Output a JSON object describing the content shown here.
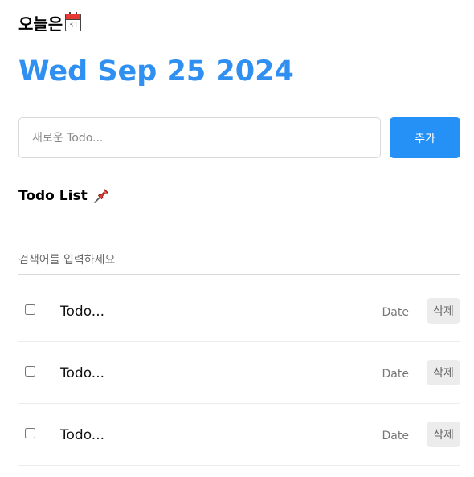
{
  "header": {
    "label": "오늘은",
    "calendar_icon": "calendar-icon",
    "calendar_icon_number": "31"
  },
  "date_title": "Wed Sep 25 2024",
  "new_todo": {
    "placeholder": "새로운 Todo...",
    "value": "",
    "add_button_label": "추가"
  },
  "list": {
    "title": "Todo List",
    "title_icon": "pushpin-icon",
    "search_placeholder": "검색어를 입력하세요",
    "search_value": "",
    "items": [
      {
        "checked": false,
        "content": "Todo...",
        "date": "Date",
        "delete_label": "삭제"
      },
      {
        "checked": false,
        "content": "Todo...",
        "date": "Date",
        "delete_label": "삭제"
      },
      {
        "checked": false,
        "content": "Todo...",
        "date": "Date",
        "delete_label": "삭제"
      }
    ]
  },
  "colors": {
    "accent": "#2f90f2",
    "button": "#2590f5",
    "delete_button_bg": "#ececec"
  }
}
